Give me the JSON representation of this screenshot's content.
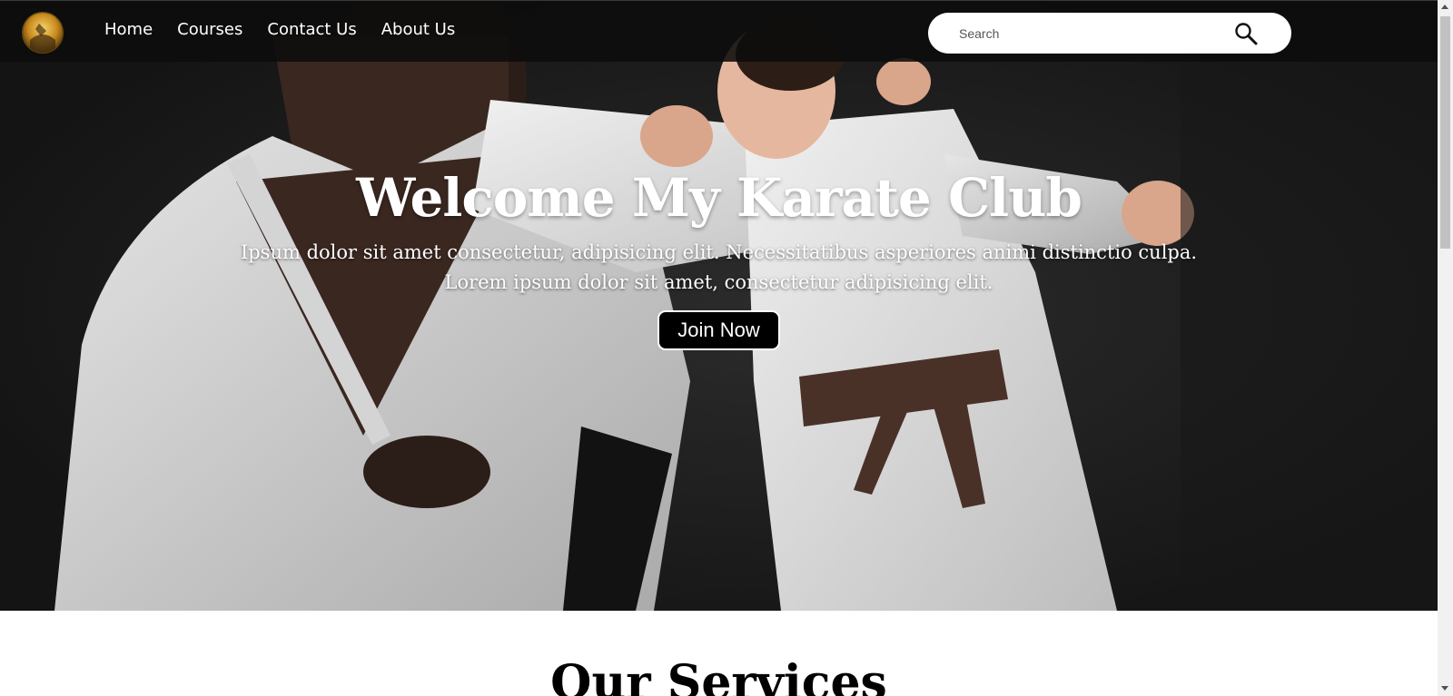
{
  "navbar": {
    "links": [
      {
        "label": "Home"
      },
      {
        "label": "Courses"
      },
      {
        "label": "Contact Us"
      },
      {
        "label": "About Us"
      }
    ],
    "search": {
      "placeholder": "Search"
    }
  },
  "hero": {
    "title": "Welcome My Karate Club",
    "subtitle_line1": "Ipsum dolor sit amet consectetur, adipisicing elit. Necessitatibus asperiores animi distinctio culpa.",
    "subtitle_line2": "Lorem ipsum dolor sit amet, consectetur adipisicing elit.",
    "cta_label": "Join Now"
  },
  "services": {
    "title": "Our Services"
  },
  "icons": {
    "logo": "club-logo",
    "search": "search-icon"
  },
  "colors": {
    "navbar_bg": "#0c0c0c",
    "button_bg": "#000000",
    "hero_text": "#ffffff"
  }
}
